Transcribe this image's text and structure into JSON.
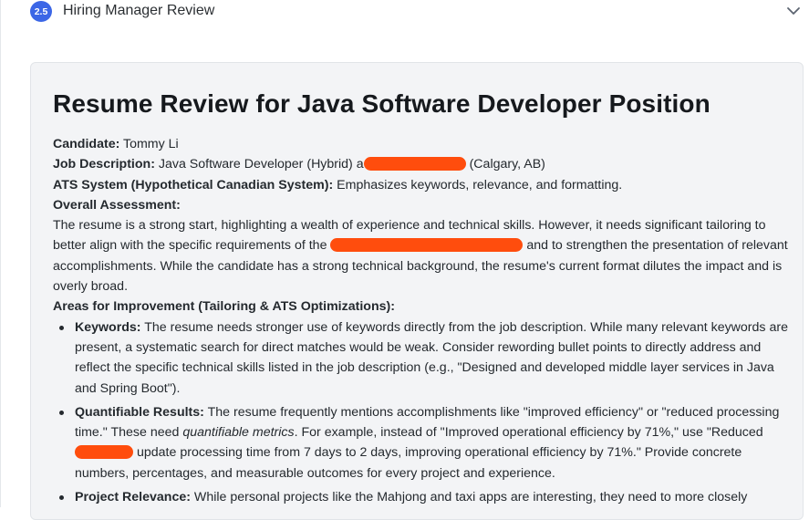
{
  "step": {
    "number": "2.5",
    "title": "Hiring Manager Review"
  },
  "review": {
    "title": "Resume Review for Java Software Developer Position",
    "candidate_label": "Candidate:",
    "candidate_value": "Tommy Li",
    "job_label": "Job Description:",
    "job_value_before": "Java Software Developer (Hybrid) a",
    "job_value_after": "(Calgary, AB)",
    "ats_label": "ATS System (Hypothetical Canadian System):",
    "ats_value": "Emphasizes keywords, relevance, and formatting.",
    "overall_heading": "Overall Assessment:",
    "overall_part1": "The resume is a strong start, highlighting a wealth of experience and technical skills. However, it needs significant tailoring to better align with the specific requirements of the",
    "overall_part2": "and to strengthen the presentation of relevant accomplishments. While the candidate has a strong technical background, the resume's current format dilutes the impact and is overly broad.",
    "areas_heading": "Areas for Improvement (Tailoring & ATS Optimizations):",
    "items": [
      {
        "label": "Keywords:",
        "text": "The resume needs stronger use of keywords directly from the job description. While many relevant keywords are present, a systematic search for direct matches would be weak. Consider rewording bullet points to directly address and reflect the specific technical skills listed in the job description (e.g., \"Designed and developed middle layer services in Java and Spring Boot\")."
      },
      {
        "label": "Quantifiable Results:",
        "text_a": "The resume frequently mentions accomplishments like \"improved efficiency\" or \"reduced processing time.\" These need",
        "text_em": "quantifiable metrics",
        "text_b": ". For example, instead of \"Improved operational efficiency by 71%,\" use \"Reduced",
        "text_c": "update processing time from 7 days to 2 days, improving operational efficiency by 71%.\" Provide concrete numbers, percentages, and measurable outcomes for every project and experience."
      },
      {
        "label": "Project Relevance:",
        "text": "While personal projects like the Mahjong and taxi apps are interesting, they need to more closely"
      }
    ]
  },
  "colors": {
    "badge": "#3b66e6",
    "redaction": "#ff4d0d",
    "card_background": "#f3f4f6"
  },
  "icons": {
    "expand": "chevron-down-icon"
  }
}
